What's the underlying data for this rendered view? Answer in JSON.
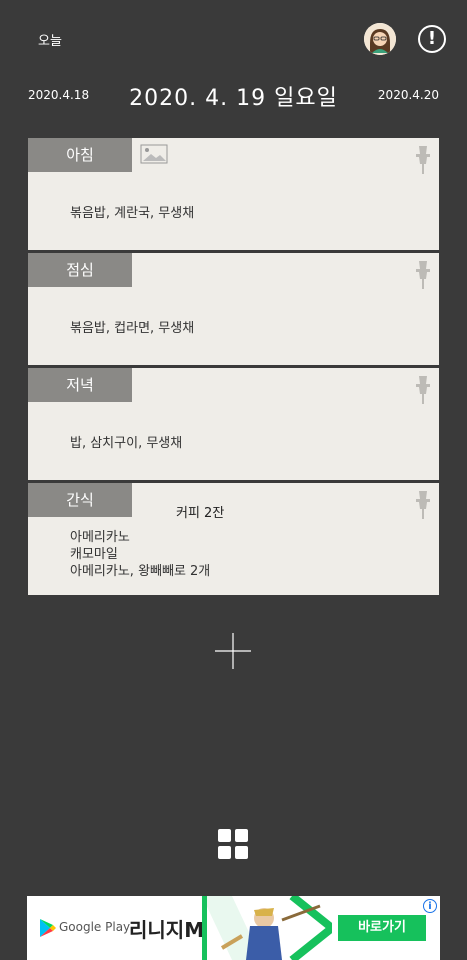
{
  "header": {
    "today_label": "오늘",
    "info_icon": "exclamation-icon"
  },
  "dates": {
    "prev": "2020.4.18",
    "current": "2020. 4. 19 일요일",
    "next": "2020.4.20"
  },
  "meals": [
    {
      "label": "아침",
      "content": "볶음밥, 계란국, 무생채",
      "has_photo": true
    },
    {
      "label": "점심",
      "content": "볶음밥, 컵라면, 무생채"
    },
    {
      "label": "저녁",
      "content": "밥, 삼치구이, 무생채"
    },
    {
      "label": "간식",
      "extra": "커피 2잔",
      "lines": [
        "아메리카노",
        "캐모마일",
        "아메리카노, 왕빼빼로 2개"
      ]
    }
  ],
  "actions": {
    "add_icon": "plus-icon",
    "grid_icon": "grid-icon"
  },
  "ad": {
    "store": "Google Play",
    "title": "리니지M",
    "cta": "바로가기",
    "info": "i"
  },
  "colors": {
    "background": "#3a3a3a",
    "card": "#efede8",
    "tab": "#8a8986",
    "cta": "#16c15c"
  }
}
